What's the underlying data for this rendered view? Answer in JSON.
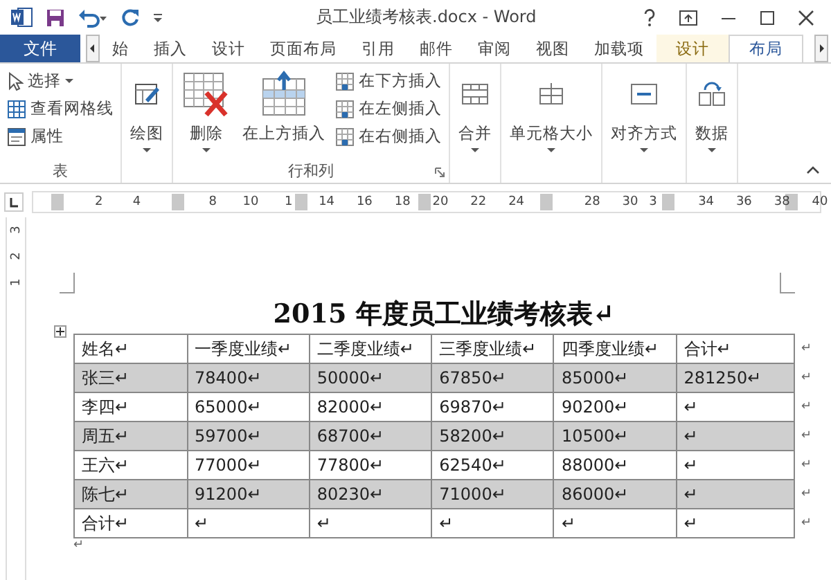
{
  "window": {
    "title": "员工业绩考核表.docx - Word"
  },
  "tabs": [
    {
      "label": "文件",
      "kind": "file",
      "selected": false
    },
    {
      "label": "始",
      "kind": "tab",
      "selected": false
    },
    {
      "label": "插入",
      "kind": "tab",
      "selected": false
    },
    {
      "label": "设计",
      "kind": "tab",
      "selected": false
    },
    {
      "label": "页面布局",
      "kind": "tab",
      "selected": false
    },
    {
      "label": "引用",
      "kind": "tab",
      "selected": false
    },
    {
      "label": "邮件",
      "kind": "tab",
      "selected": false
    },
    {
      "label": "审阅",
      "kind": "tab",
      "selected": false
    },
    {
      "label": "视图",
      "kind": "tab",
      "selected": false
    },
    {
      "label": "加载项",
      "kind": "tab",
      "selected": false
    },
    {
      "label": "设计",
      "kind": "context",
      "selected": false
    },
    {
      "label": "布局",
      "kind": "context",
      "selected": true
    }
  ],
  "ribbon": {
    "groups": [
      {
        "label": "表",
        "buttons": [
          {
            "label": "选择",
            "kind": "small",
            "dropdown": true
          },
          {
            "label": "查看网格线",
            "kind": "small",
            "dropdown": false
          },
          {
            "label": "属性",
            "kind": "small",
            "dropdown": false
          }
        ]
      },
      {
        "buttons": [
          {
            "label": "绘图",
            "kind": "large",
            "dropdown": true
          }
        ]
      },
      {
        "label": "行和列",
        "buttons": [
          {
            "label": "删除",
            "kind": "large",
            "dropdown": true
          },
          {
            "label": "在上方插入",
            "kind": "large",
            "dropdown": false
          },
          {
            "label": "在下方插入",
            "kind": "small",
            "dropdown": false
          },
          {
            "label": "在左侧插入",
            "kind": "small",
            "dropdown": false
          },
          {
            "label": "在右侧插入",
            "kind": "small",
            "dropdown": false
          }
        ]
      },
      {
        "buttons": [
          {
            "label": "合并",
            "kind": "large",
            "dropdown": true
          }
        ]
      },
      {
        "buttons": [
          {
            "label": "单元格大小",
            "kind": "large",
            "dropdown": true
          }
        ]
      },
      {
        "buttons": [
          {
            "label": "对齐方式",
            "kind": "large",
            "dropdown": true
          }
        ]
      },
      {
        "buttons": [
          {
            "label": "数据",
            "kind": "large",
            "dropdown": true
          }
        ]
      }
    ]
  },
  "ruler": {
    "labels": [
      "2",
      "4",
      "8",
      "10",
      "1",
      "14",
      "16",
      "18",
      "20",
      "22",
      "24",
      "28",
      "30",
      "3",
      "34",
      "36",
      "38",
      "40"
    ],
    "vertical_labels": [
      "3",
      "2",
      "1"
    ]
  },
  "document": {
    "title": "2015 年度员工业绩考核表↵",
    "table": {
      "columns": [
        "姓名↵",
        "一季度业绩↵",
        "二季度业绩↵",
        "三季度业绩↵",
        "四季度业绩↵",
        "合计↵"
      ],
      "rows": [
        {
          "shaded": true,
          "cells": [
            "张三↵",
            "78400↵",
            "50000↵",
            "67850↵",
            "85000↵",
            "281250↵"
          ]
        },
        {
          "shaded": false,
          "cells": [
            "李四↵",
            "65000↵",
            "82000↵",
            "69870↵",
            "90200↵",
            "↵"
          ]
        },
        {
          "shaded": true,
          "cells": [
            "周五↵",
            "59700↵",
            "68700↵",
            "58200↵",
            "10500↵",
            "↵"
          ]
        },
        {
          "shaded": false,
          "cells": [
            "王六↵",
            "77000↵",
            "77800↵",
            "62540↵",
            "88000↵",
            "↵"
          ]
        },
        {
          "shaded": true,
          "cells": [
            "陈七↵",
            "91200↵",
            "80230↵",
            "71000↵",
            "86000↵",
            "↵"
          ]
        },
        {
          "shaded": false,
          "cells": [
            "合计↵",
            "↵",
            "↵",
            "↵",
            "↵",
            "↵"
          ]
        }
      ],
      "row_end_marks": [
        "↵",
        "↵",
        "↵",
        "↵",
        "↵",
        "↵",
        "↵"
      ]
    },
    "end_mark": "↵"
  }
}
